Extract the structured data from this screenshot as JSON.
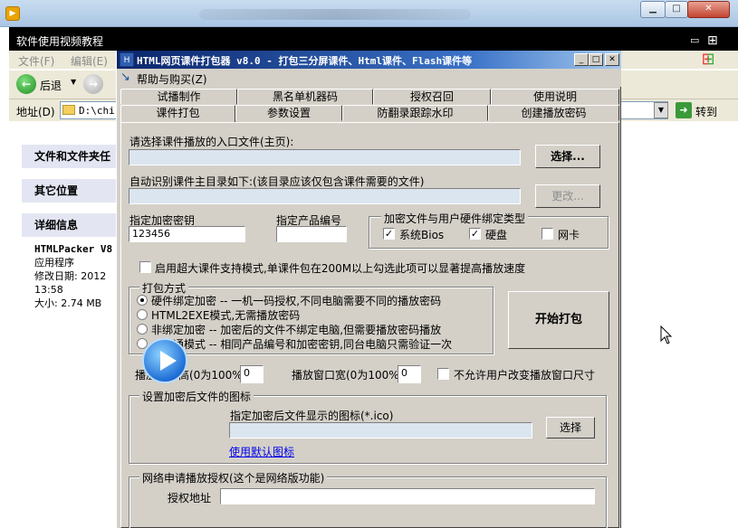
{
  "explorer": {
    "title_row": "软件使用视频教程",
    "menu": [
      "文件(F)",
      "编辑(E)"
    ],
    "back_label": "后退",
    "address_label": "地址(D)",
    "address_value": "D:\\chi",
    "go_label": "转到",
    "left_pane": {
      "header_files": "文件和文件夹任",
      "header_other": "其它位置",
      "header_details": "详细信息",
      "details_name": "HTMLPacker V8",
      "details_type": "应用程序",
      "details_modified_label": "修改日期: 2012",
      "details_modified_time": "13:58",
      "details_size": "大小: 2.74 MB"
    }
  },
  "dialog": {
    "title": "HTML网页课件打包器 v8.0 - 打包三分屏课件、Html课件、Flash课件等",
    "menu_item": "帮助与购买(Z)",
    "tabs_row1": [
      "试播制作",
      "黑名单机器码",
      "授权召回",
      "使用说明"
    ],
    "tabs_row2": [
      "课件打包",
      "参数设置",
      "防翻录跟踪水印",
      "创建播放密码"
    ],
    "entry_label": "请选择课件播放的入口文件(主页):",
    "entry_value": "",
    "select_button": "选择...",
    "auto_dir_label": "自动识别课件主目录如下:(该目录应该仅包含课件需要的文件)",
    "auto_dir_value": "",
    "change_button": "更改...",
    "key_label": "指定加密密钥",
    "key_value": "123456",
    "product_label": "指定产品编号",
    "product_value": "",
    "bind_group_title": "加密文件与用户硬件绑定类型",
    "bind_options": [
      {
        "label": "系统Bios",
        "checked": true
      },
      {
        "label": "硬盘",
        "checked": true
      },
      {
        "label": "网卡",
        "checked": false
      }
    ],
    "large_mode_label": "启用超大课件支持模式,单课件包在200M以上勾选此项可以显著提高播放速度",
    "pack_group_title": "打包方式",
    "pack_options": [
      {
        "label": "硬件绑定加密 -- 一机一码授权,不同电脑需要不同的播放密码",
        "selected": true
      },
      {
        "label": "HTML2EXE模式,无需播放密码",
        "selected": false
      },
      {
        "label": "非绑定加密 -- 加密后的文件不绑定电脑,但需要播放密码播放",
        "selected": false
      },
      {
        "label": "一码通模式 -- 相同产品编号和加密密钥,同台电脑只需验证一次",
        "selected": false
      }
    ],
    "start_button": "开始打包",
    "height_label": "播放窗口高(0为100%)",
    "height_value": "0",
    "width_label": "播放窗口宽(0为100%)",
    "width_value": "0",
    "no_resize_label": "不允许用户改变播放窗口尺寸",
    "icon_group_title": "设置加密后文件的图标",
    "icon_label": "指定加密后文件显示的图标(*.ico)",
    "icon_value": "",
    "icon_select_button": "选择",
    "default_icon_link": "使用默认图标",
    "network_group_title": "网络申请播放授权(这个是网络版功能)",
    "auth_addr_label": "授权地址",
    "auth_addr_value": ""
  }
}
